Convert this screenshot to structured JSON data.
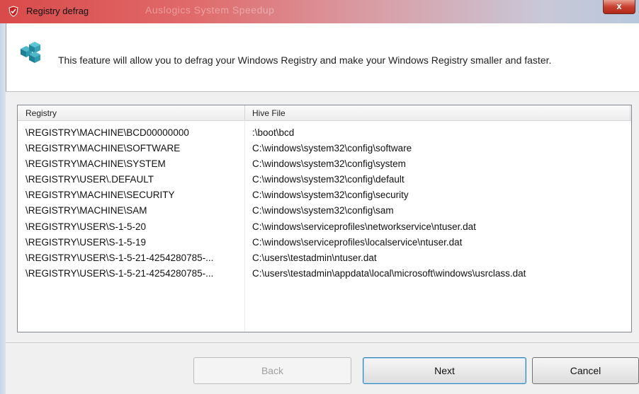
{
  "window": {
    "title": "Registry defrag",
    "ghost_title": "Auslogics System Speedup",
    "close_label": "x"
  },
  "header": {
    "description": "This feature will allow you to defrag your Windows Registry and make your Windows Registry smaller and faster."
  },
  "list": {
    "columns": [
      "Registry",
      "Hive File"
    ],
    "rows": [
      {
        "registry": "\\REGISTRY\\MACHINE\\BCD00000000",
        "hive": " :\\boot\\bcd"
      },
      {
        "registry": "\\REGISTRY\\MACHINE\\SOFTWARE",
        "hive": "C:\\windows\\system32\\config\\software"
      },
      {
        "registry": "\\REGISTRY\\MACHINE\\SYSTEM",
        "hive": "C:\\windows\\system32\\config\\system"
      },
      {
        "registry": "\\REGISTRY\\USER\\.DEFAULT",
        "hive": "C:\\windows\\system32\\config\\default"
      },
      {
        "registry": "\\REGISTRY\\MACHINE\\SECURITY",
        "hive": "C:\\windows\\system32\\config\\security"
      },
      {
        "registry": "\\REGISTRY\\MACHINE\\SAM",
        "hive": "C:\\windows\\system32\\config\\sam"
      },
      {
        "registry": "\\REGISTRY\\USER\\S-1-5-20",
        "hive": "C:\\windows\\serviceprofiles\\networkservice\\ntuser.dat"
      },
      {
        "registry": "\\REGISTRY\\USER\\S-1-5-19",
        "hive": "C:\\windows\\serviceprofiles\\localservice\\ntuser.dat"
      },
      {
        "registry": "\\REGISTRY\\USER\\S-1-5-21-4254280785-...",
        "hive": "C:\\users\\testadmin\\ntuser.dat"
      },
      {
        "registry": "\\REGISTRY\\USER\\S-1-5-21-4254280785-...",
        "hive": "C:\\users\\testadmin\\appdata\\local\\microsoft\\windows\\usrclass.dat"
      }
    ]
  },
  "buttons": {
    "back": "Back",
    "next": "Next",
    "cancel": "Cancel"
  },
  "colors": {
    "titlebar_accent": "#d94a4a",
    "close_button": "#c84030",
    "default_button_border": "#3c7fb1"
  },
  "icons": {
    "title": "app-shield-icon",
    "header": "registry-cubes-icon"
  }
}
